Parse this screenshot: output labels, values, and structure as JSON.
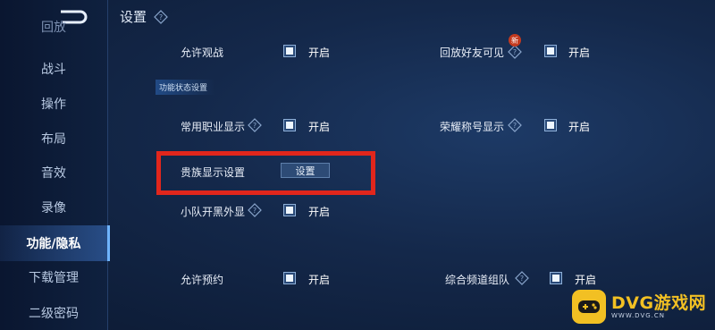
{
  "header": {
    "title": "设置"
  },
  "sidebar": {
    "items": [
      {
        "label": "回放"
      },
      {
        "label": "战斗"
      },
      {
        "label": "操作"
      },
      {
        "label": "布局"
      },
      {
        "label": "音效"
      },
      {
        "label": "录像"
      },
      {
        "label": "功能/隐私"
      },
      {
        "label": "下载管理"
      },
      {
        "label": "二级密码"
      }
    ]
  },
  "settings": {
    "allow_spectate": {
      "label": "允许观战",
      "state": "开启"
    },
    "replay_friends": {
      "label": "回放好友可见",
      "state": "开启",
      "badge": "新"
    },
    "section_title": "功能状态设置",
    "common_job": {
      "label": "常用职业显示",
      "state": "开启"
    },
    "honor_title": {
      "label": "荣耀称号显示",
      "state": "开启"
    },
    "noble_display": {
      "label": "贵族显示设置",
      "button": "设置"
    },
    "squad_black": {
      "label": "小队开黑外显",
      "state": "开启"
    },
    "allow_reserve": {
      "label": "允许预约",
      "state": "开启"
    },
    "channel_team": {
      "label": "综合频道组队",
      "state": "开启"
    }
  },
  "watermark": {
    "title": "DVG游戏网",
    "url": "WWW.DVG.CN"
  },
  "colors": {
    "highlight": "#e1261c",
    "accent": "#6fb4ff",
    "watermark": "#f2c023"
  }
}
